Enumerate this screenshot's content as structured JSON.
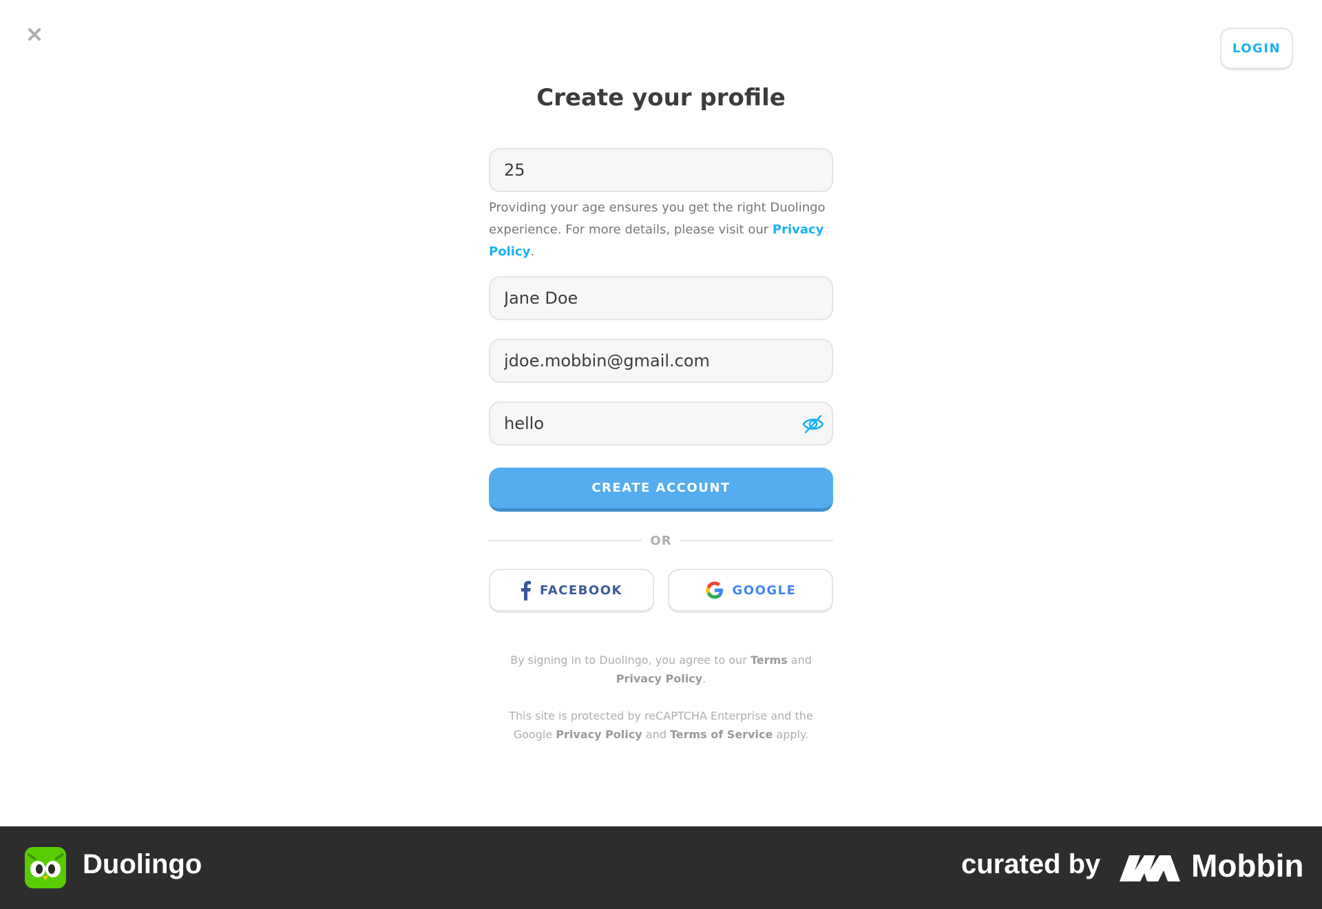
{
  "header": {
    "close_icon": "close-icon",
    "login_label": "LOGIN"
  },
  "form": {
    "title": "Create your profile",
    "age_value": "25",
    "age_help_text": "Providing your age ensures you get the right Duolingo experience. For more details, please visit our ",
    "age_help_link": "Privacy Policy",
    "age_help_end": ".",
    "name_value": "Jane Doe",
    "email_value": "jdoe.mobbin@gmail.com",
    "password_value": "hello",
    "password_toggle_icon": "eye-off-icon",
    "create_label": "CREATE ACCOUNT",
    "or_label": "OR",
    "facebook_label": "FACEBOOK",
    "google_label": "GOOGLE"
  },
  "legal": {
    "terms_prefix": "By signing in to Duolingo, you agree to our ",
    "terms_link": "Terms",
    "terms_and": " and ",
    "privacy_link": "Privacy Policy",
    "terms_end": ".",
    "recaptcha_prefix": "This site is protected by reCAPTCHA Enterprise and the Google ",
    "recaptcha_privacy": "Privacy Policy",
    "recaptcha_and": " and ",
    "recaptcha_terms": "Terms of Service",
    "recaptcha_end": " apply."
  },
  "footer": {
    "brand": "Duolingo",
    "curated_by": "curated by",
    "mobbin": "Mobbin"
  },
  "colors": {
    "accent": "#1cb0f6",
    "button": "#55acee",
    "footer_bg": "#2d2d2d",
    "owl_green": "#58cc02"
  }
}
